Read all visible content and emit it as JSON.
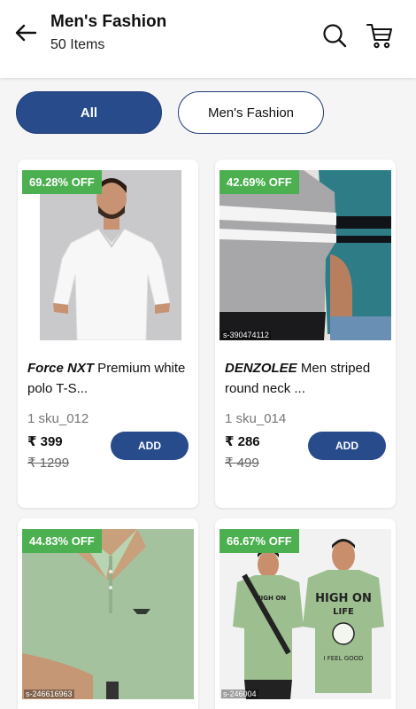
{
  "header": {
    "title": "Men's Fashion",
    "subtitle": "50 Items"
  },
  "filters": [
    {
      "label": "All",
      "selected": true
    },
    {
      "label": "Men's Fashion",
      "selected": false
    }
  ],
  "colors": {
    "primary": "#284b8c",
    "discount_badge": "#4caf50"
  },
  "products": [
    {
      "discount": "69.28% OFF",
      "brand": "Force NXT",
      "name": " Premium white polo T-S...",
      "code": "1 sku_012",
      "price": "₹ 399",
      "mrp": "₹ 1299",
      "add_label": "ADD",
      "image": "white-polo-shirt"
    },
    {
      "discount": "42.69% OFF",
      "brand": "DENZOLEE",
      "name": " Men striped round neck ...",
      "code": "1 sku_014",
      "price": "₹ 286",
      "mrp": "₹ 499",
      "add_label": "ADD",
      "image_tag": "s-390474112",
      "image": "striped-tshirts"
    },
    {
      "discount": "44.83% OFF",
      "image_tag": "s-246616963",
      "image": "green-polo-shirt"
    },
    {
      "discount": "66.67% OFF",
      "image_tag": "s-246004",
      "image": "green-graphic-tees"
    }
  ]
}
